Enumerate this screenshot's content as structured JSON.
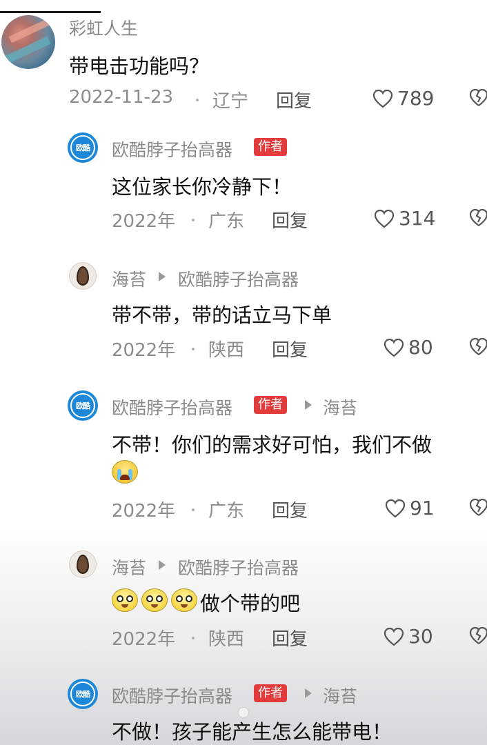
{
  "comments": [
    {
      "user": "彩虹人生",
      "text": "带电击功能吗？",
      "date": "2022-11-23",
      "location": "辽宁",
      "reply_label": "回复",
      "likes": "789"
    },
    {
      "user": "欧酷脖子抬高器",
      "badge": "作者",
      "text": "这位家长你冷静下！",
      "date": "2022年",
      "location": "广东",
      "reply_label": "回复",
      "likes": "314"
    },
    {
      "user": "海苔",
      "reply_to": "欧酷脖子抬高器",
      "text": "带不带，带的话立马下单",
      "date": "2022年",
      "location": "陕西",
      "reply_label": "回复",
      "likes": "80"
    },
    {
      "user": "欧酷脖子抬高器",
      "badge": "作者",
      "reply_to": "海苔",
      "text": "不带！你们的需求好可怕，我们不做",
      "emoji": "crying-face",
      "date": "2022年",
      "location": "广东",
      "reply_label": "回复",
      "likes": "91"
    },
    {
      "user": "海苔",
      "reply_to": "欧酷脖子抬高器",
      "emojis": [
        "pleading-face",
        "pleading-face",
        "pleading-face"
      ],
      "text": "做个带的吧",
      "date": "2022年",
      "location": "陕西",
      "reply_label": "回复",
      "likes": "30"
    },
    {
      "user": "欧酷脖子抬高器",
      "badge": "作者",
      "reply_to": "海苔",
      "text": "不做！孩子能产生怎么能带电！"
    }
  ],
  "brand_avatar_text": "欧酷",
  "icons": {
    "like": "heart-outline-icon",
    "dislike": "broken-heart-icon",
    "reply_arrow": "triangle-right-icon"
  },
  "colors": {
    "badge": "#e33b3b",
    "brand": "#1e88d8",
    "meta": "#8c8c8c"
  }
}
